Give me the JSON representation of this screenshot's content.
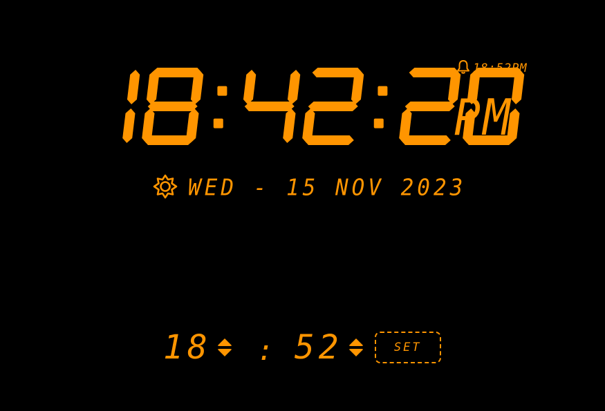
{
  "clock": {
    "hours": "18",
    "minutes": "42",
    "seconds": "20",
    "ampm": "PM",
    "digit_color": "#ff9500",
    "background_color": "#000000"
  },
  "alarm_indicator": {
    "icon": "bell-icon",
    "time": "18:52PM"
  },
  "date": {
    "icon": "sun-icon",
    "text": "WED - 15 NOV 2023"
  },
  "alarm_setter": {
    "hour": "18",
    "separator": ":",
    "minute": "52",
    "set_label": "SET",
    "stepper_icons": [
      "chevron-up-icon",
      "chevron-down-icon"
    ]
  }
}
